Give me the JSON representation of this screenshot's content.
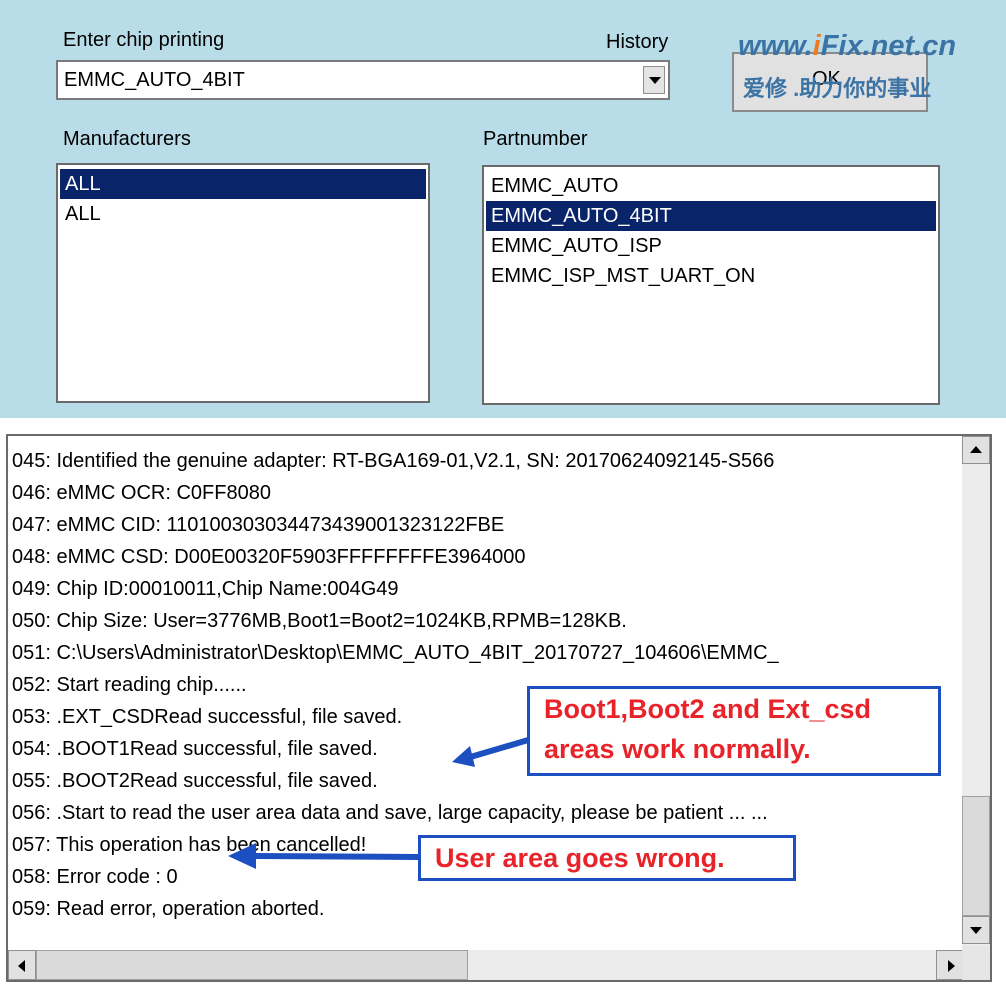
{
  "top": {
    "enter_chip_label": "Enter chip printing",
    "history_label": "History",
    "chip_value": "EMMC_AUTO_4BIT",
    "ok_label": "OK",
    "manufacturers_label": "Manufacturers",
    "partnumber_label": "Partnumber"
  },
  "watermark": {
    "pre": "www.",
    "hi": "i",
    "post": "Fix.net.cn",
    "cn": "爱修 .助力你的事业"
  },
  "manufacturers": [
    "ALL",
    "ALL"
  ],
  "partnumbers": [
    "EMMC_AUTO",
    "EMMC_AUTO_4BIT",
    "EMMC_AUTO_ISP",
    "EMMC_ISP_MST_UART_ON"
  ],
  "log": [
    "045: Identified the genuine adapter: RT-BGA169-01,V2.1, SN: 20170624092145-S566",
    "046: eMMC OCR: C0FF8080",
    "047: eMMC CID:  110100303034473439001323122FBE",
    "048: eMMC CSD: D00E00320F5903FFFFFFFFE3964000",
    "049: Chip ID:00010011,Chip Name:004G49",
    "050: Chip Size: User=3776MB,Boot1=Boot2=1024KB,RPMB=128KB.",
    "051: C:\\Users\\Administrator\\Desktop\\EMMC_AUTO_4BIT_20170727_104606\\EMMC_",
    "052: Start reading chip......",
    "053: .EXT_CSDRead successful, file saved.",
    "054: .BOOT1Read successful, file saved.",
    "055: .BOOT2Read successful, file saved.",
    "056: .Start to read the user area data and save, large capacity, please be patient ... ...",
    "057: This operation has been cancelled!",
    "058: Error code : 0",
    "059: Read error, operation aborted."
  ],
  "callouts": {
    "boot_line1": "Boot1,Boot2 and Ext_csd",
    "boot_line2": "areas work normally.",
    "user_area": "User area goes wrong."
  },
  "colors": {
    "panel_bg": "#b9dde8",
    "selection": "#0a246a",
    "callout_border": "#1c4fbf",
    "callout_text": "#e8232a",
    "arrow": "#1c4fbf"
  }
}
